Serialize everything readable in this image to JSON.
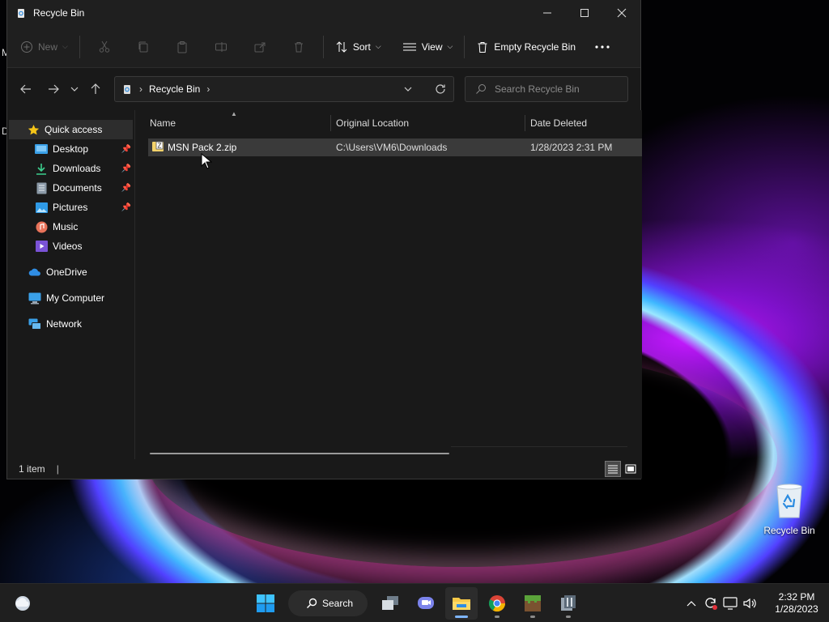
{
  "window": {
    "title": "Recycle Bin",
    "minimize_icon": "minimize-icon",
    "maximize_icon": "maximize-icon",
    "close_icon": "close-icon"
  },
  "toolbar": {
    "new_label": "New",
    "sort_label": "Sort",
    "view_label": "View",
    "empty_label": "Empty Recycle Bin",
    "disabled_icons": [
      "cut-icon",
      "copy-icon",
      "paste-icon",
      "rename-icon",
      "share-icon",
      "delete-icon"
    ]
  },
  "address": {
    "crumb": "Recycle Bin",
    "search_placeholder": "Search Recycle Bin"
  },
  "nav": {
    "quick_access": "Quick access",
    "desktop": "Desktop",
    "downloads": "Downloads",
    "documents": "Documents",
    "pictures": "Pictures",
    "music": "Music",
    "videos": "Videos",
    "onedrive": "OneDrive",
    "my_computer": "My Computer",
    "network": "Network"
  },
  "columns": {
    "name": "Name",
    "original_location": "Original Location",
    "date_deleted": "Date Deleted"
  },
  "files": [
    {
      "name": "MSN Pack 2.zip",
      "location": "C:\\Users\\VM6\\Downloads",
      "date": "1/28/2023 2:31 PM"
    }
  ],
  "status": {
    "count": "1 item"
  },
  "desktop": {
    "recycle_bin_label": "Recycle Bin",
    "edge_stub_1": "M",
    "edge_stub_2": "D"
  },
  "taskbar": {
    "search_label": "Search",
    "time": "2:32 PM",
    "date": "1/28/2023"
  },
  "colors": {
    "window_bg": "#191919",
    "selection": "#3a3a3a",
    "accent": "#7fb6ff",
    "taskbar_bg": "#1f1f1f"
  }
}
